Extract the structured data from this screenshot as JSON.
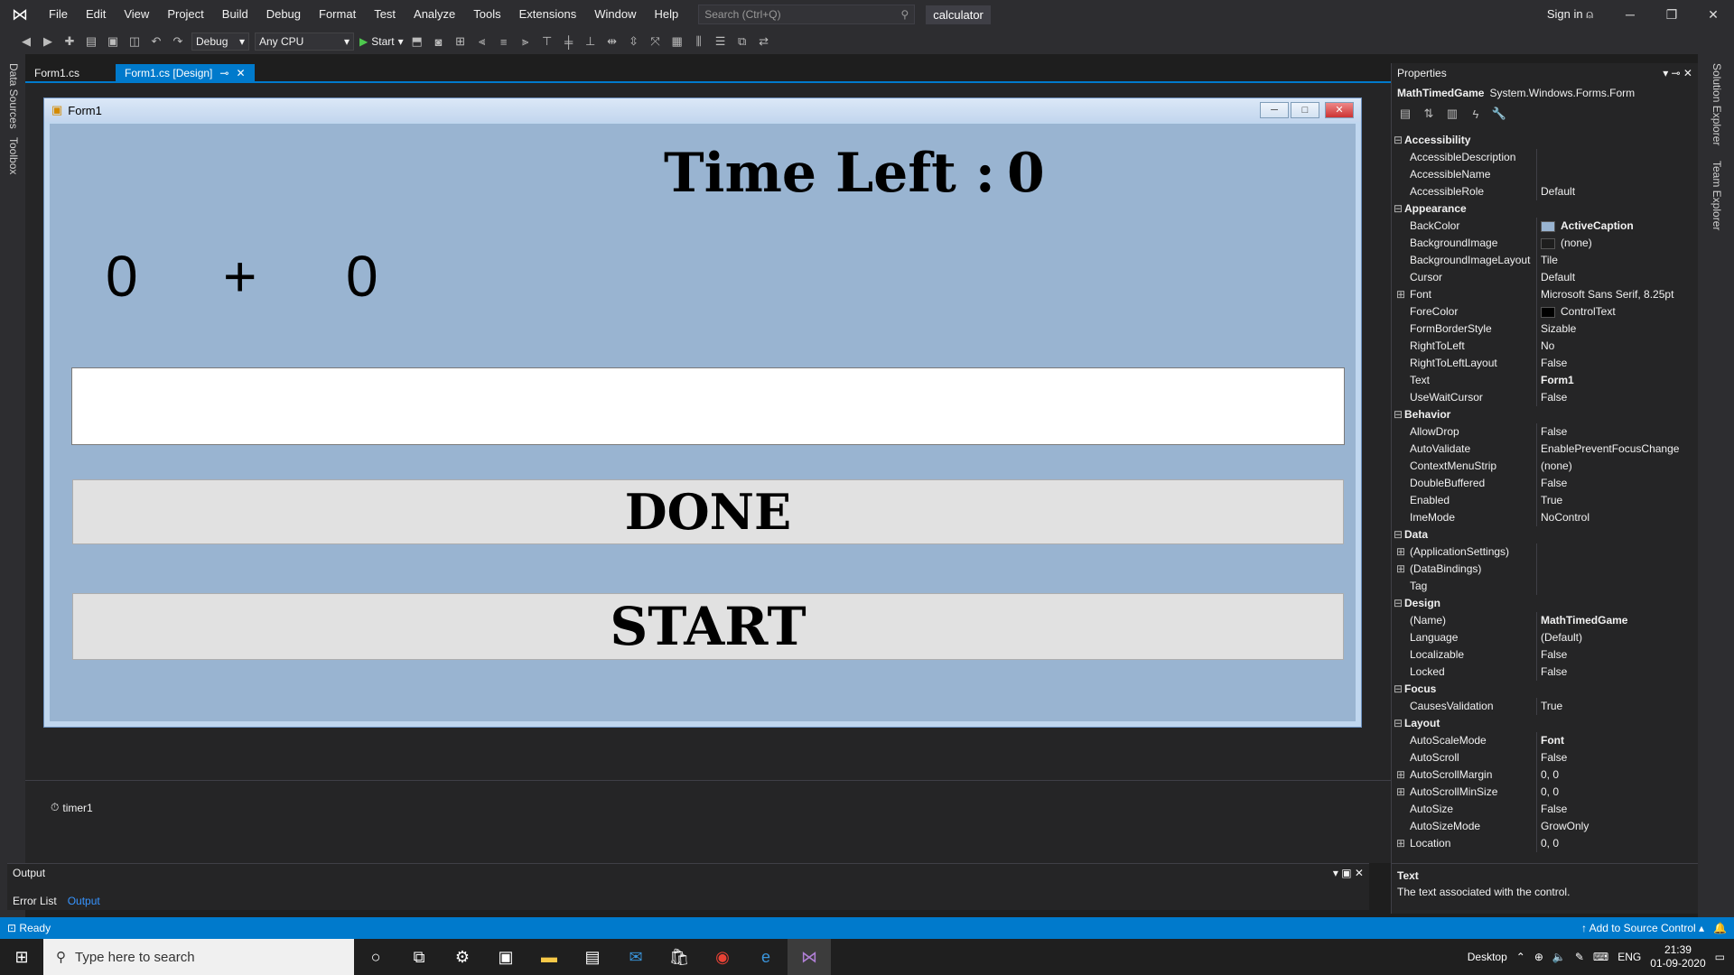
{
  "menu": [
    "File",
    "Edit",
    "View",
    "Project",
    "Build",
    "Debug",
    "Format",
    "Test",
    "Analyze",
    "Tools",
    "Extensions",
    "Window",
    "Help"
  ],
  "search": {
    "placeholder": "Search (Ctrl+Q)"
  },
  "solution_name": "calculator",
  "signin": "Sign in",
  "toolbar": {
    "config": "Debug",
    "platform": "Any CPU",
    "start": "Start"
  },
  "left_strip": {
    "data_sources": "Data Sources",
    "toolbox": "Toolbox"
  },
  "right_strip": {
    "solution_explorer": "Solution Explorer",
    "team_explorer": "Team Explorer"
  },
  "tabs": [
    {
      "label": "Form1.cs"
    },
    {
      "label": "Form1.cs [Design]"
    }
  ],
  "form": {
    "title": "Form1",
    "time_left_label": "Time Left :",
    "time_left_value": "0",
    "addend_left": "0",
    "plus_sign": "+",
    "addend_right": "0",
    "done_button": "DONE",
    "start_button": "START"
  },
  "tray": {
    "timer": "timer1"
  },
  "output": {
    "title": "Output",
    "tabs": [
      "Error List",
      "Output"
    ]
  },
  "properties": {
    "title": "Properties",
    "object_name": "MathTimedGame",
    "object_type": "System.Windows.Forms.Form",
    "rows": [
      {
        "cat": true,
        "name": "Accessibility"
      },
      {
        "name": "AccessibleDescription",
        "value": ""
      },
      {
        "name": "AccessibleName",
        "value": ""
      },
      {
        "name": "AccessibleRole",
        "value": "Default"
      },
      {
        "cat": true,
        "name": "Appearance"
      },
      {
        "name": "BackColor",
        "value": "ActiveCaption",
        "swatch": "#99b4d1",
        "bold": true
      },
      {
        "name": "BackgroundImage",
        "value": "(none)",
        "swatch": "#1e1e1e"
      },
      {
        "name": "BackgroundImageLayout",
        "value": "Tile"
      },
      {
        "name": "Cursor",
        "value": "Default"
      },
      {
        "name": "Font",
        "value": "Microsoft Sans Serif, 8.25pt",
        "expand": true
      },
      {
        "name": "ForeColor",
        "value": "ControlText",
        "swatch": "#000000"
      },
      {
        "name": "FormBorderStyle",
        "value": "Sizable"
      },
      {
        "name": "RightToLeft",
        "value": "No"
      },
      {
        "name": "RightToLeftLayout",
        "value": "False"
      },
      {
        "name": "Text",
        "value": "Form1",
        "bold": true
      },
      {
        "name": "UseWaitCursor",
        "value": "False"
      },
      {
        "cat": true,
        "name": "Behavior"
      },
      {
        "name": "AllowDrop",
        "value": "False"
      },
      {
        "name": "AutoValidate",
        "value": "EnablePreventFocusChange"
      },
      {
        "name": "ContextMenuStrip",
        "value": "(none)"
      },
      {
        "name": "DoubleBuffered",
        "value": "False"
      },
      {
        "name": "Enabled",
        "value": "True"
      },
      {
        "name": "ImeMode",
        "value": "NoControl"
      },
      {
        "cat": true,
        "name": "Data"
      },
      {
        "name": "(ApplicationSettings)",
        "value": "",
        "expand": true
      },
      {
        "name": "(DataBindings)",
        "value": "",
        "expand": true
      },
      {
        "name": "Tag",
        "value": ""
      },
      {
        "cat": true,
        "name": "Design"
      },
      {
        "name": "(Name)",
        "value": "MathTimedGame",
        "bold": true
      },
      {
        "name": "Language",
        "value": "(Default)"
      },
      {
        "name": "Localizable",
        "value": "False"
      },
      {
        "name": "Locked",
        "value": "False"
      },
      {
        "cat": true,
        "name": "Focus"
      },
      {
        "name": "CausesValidation",
        "value": "True"
      },
      {
        "cat": true,
        "name": "Layout"
      },
      {
        "name": "AutoScaleMode",
        "value": "Font",
        "bold": true
      },
      {
        "name": "AutoScroll",
        "value": "False"
      },
      {
        "name": "AutoScrollMargin",
        "value": "0, 0",
        "expand": true
      },
      {
        "name": "AutoScrollMinSize",
        "value": "0, 0",
        "expand": true
      },
      {
        "name": "AutoSize",
        "value": "False"
      },
      {
        "name": "AutoSizeMode",
        "value": "GrowOnly"
      },
      {
        "name": "Location",
        "value": "0, 0",
        "expand": true
      }
    ],
    "desc_title": "Text",
    "desc_text": "The text associated with the control."
  },
  "status": {
    "left": "Ready",
    "right": "Add to Source Control"
  },
  "taskbar": {
    "search_placeholder": "Type here to search",
    "desktop": "Desktop",
    "lang": "ENG",
    "time": "21:39",
    "date": "01-09-2020"
  },
  "colors": {
    "accent": "#007acc",
    "form_back": "#99b4d1"
  }
}
